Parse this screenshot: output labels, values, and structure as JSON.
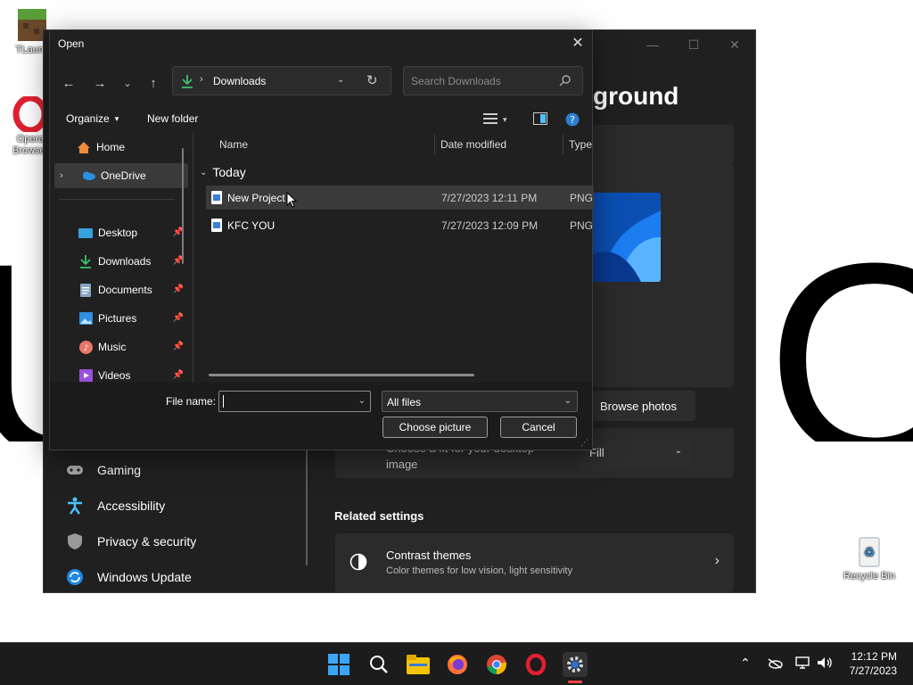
{
  "wallpaper": {
    "letters": [
      "U",
      "O",
      "U"
    ]
  },
  "desktop_icons": [
    {
      "label": "TLaunc",
      "icon": "minecraft-icon"
    },
    {
      "label": "Opera Browser",
      "icon": "opera-icon"
    },
    {
      "label": "Recycle Bin",
      "icon": "recycle-bin-icon"
    }
  ],
  "settings": {
    "heading": "ground",
    "browse_photos": "Browse photos",
    "fit_label": "Fill",
    "fit_desc_line1": "Choose a fit for your desktop",
    "fit_desc_line2": "image",
    "nav": [
      {
        "label": "Gaming",
        "icon": "gamepad-icon"
      },
      {
        "label": "Accessibility",
        "icon": "accessibility-icon"
      },
      {
        "label": "Privacy & security",
        "icon": "shield-icon"
      },
      {
        "label": "Windows Update",
        "icon": "update-icon"
      }
    ],
    "related_title": "Related settings",
    "contrast_title": "Contrast themes",
    "contrast_sub": "Color themes for low vision, light sensitivity"
  },
  "dialog": {
    "title": "Open",
    "address": "Downloads",
    "search_placeholder": "Search Downloads",
    "organize": "Organize",
    "new_folder": "New folder",
    "nav_items": [
      {
        "label": "Home",
        "icon": "home-icon"
      },
      {
        "label": "OneDrive",
        "icon": "cloud-icon"
      },
      {
        "label": "Desktop",
        "icon": "desktop-icon"
      },
      {
        "label": "Downloads",
        "icon": "download-icon"
      },
      {
        "label": "Documents",
        "icon": "document-icon"
      },
      {
        "label": "Pictures",
        "icon": "pictures-icon"
      },
      {
        "label": "Music",
        "icon": "music-icon"
      },
      {
        "label": "Videos",
        "icon": "videos-icon"
      }
    ],
    "columns": {
      "name": "Name",
      "date": "Date modified",
      "type": "Type"
    },
    "group": "Today",
    "files": [
      {
        "name": "New Project",
        "date": "7/27/2023 12:11 PM",
        "type": "PNG"
      },
      {
        "name": "KFC YOU",
        "date": "7/27/2023 12:09 PM",
        "type": "PNG"
      }
    ],
    "file_name_label": "File name:",
    "file_name_value": "",
    "filter": "All files",
    "choose_button": "Choose picture",
    "cancel_button": "Cancel"
  },
  "taskbar": {
    "apps": [
      "start-icon",
      "search-icon",
      "file-explorer-icon",
      "firefox-icon",
      "chrome-icon",
      "opera-icon",
      "settings-icon"
    ],
    "time": "12:12 PM",
    "date": "7/27/2023"
  },
  "colors": {
    "accent": "#4cc2ff",
    "dialog_bg": "#202020",
    "taskbar_bg": "#1c1c1c"
  }
}
